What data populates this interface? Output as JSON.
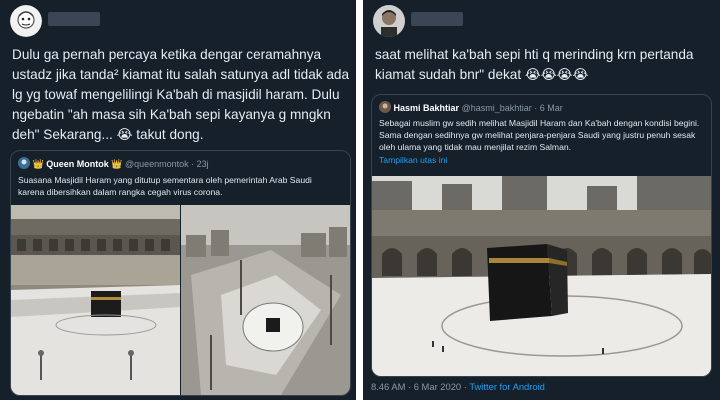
{
  "left_tweet": {
    "text": "Dulu ga pernah percaya ketika dengar ceramahnya ustadz jika tanda² kiamat itu salah satunya adl tidak ada lg yg towaf mengelilingi Ka'bah di masjidil haram. Dulu ngebatin \"ah masa sih Ka'bah sepi kayanya g mngkn deh\" Sekarang... 😭 takut dong.",
    "quote": {
      "badge_left": "👑",
      "name": "Queen Montok",
      "badge_right": "👑",
      "handle_time": "@queenmontok · 23j",
      "text": "Suasana Masjidil Haram yang ditutup sementara oleh pemerintah Arab Saudi karena dibersihkan dalam rangka cegah virus corona."
    }
  },
  "right_tweet": {
    "text": "saat melihat ka'bah sepi hti q merinding krn pertanda kiamat sudah bnr\" dekat 😭😭😭😭",
    "quote": {
      "name": "Hasmi Bakhtiar",
      "handle_time": "@hasmi_bakhtiar · 6 Mar",
      "text": "Sebagai muslim gw sedih melihat Masjidil Haram dan Ka'bah dengan kondisi begini. Sama dengan sedihnya gw melihat penjara-penjara Saudi yang justru penuh sesak oleh ulama yang tidak mau menjilat rezim Salman.",
      "thread_link": "Tampilkan utas ini"
    },
    "footer": {
      "time": "8.46 AM · 6 Mar 2020 · ",
      "app": "Twitter for Android"
    }
  },
  "colors": {
    "background": "#15202b",
    "border": "#38444d",
    "link": "#1da1f2",
    "muted": "#8899a6"
  }
}
